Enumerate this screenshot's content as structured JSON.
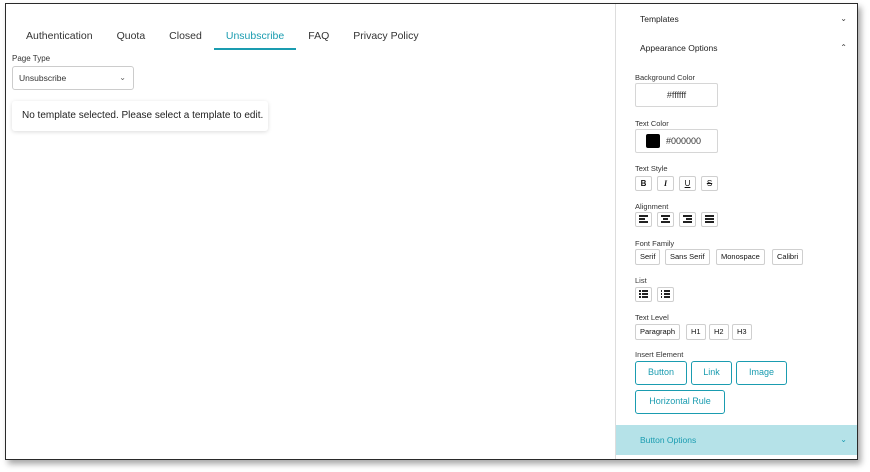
{
  "tabs": [
    {
      "label": "Authentication",
      "active": false
    },
    {
      "label": "Quota",
      "active": false
    },
    {
      "label": "Closed",
      "active": false
    },
    {
      "label": "Unsubscribe",
      "active": true
    },
    {
      "label": "FAQ",
      "active": false
    },
    {
      "label": "Privacy Policy",
      "active": false
    }
  ],
  "page_type": {
    "label": "Page Type",
    "selected": "Unsubscribe"
  },
  "notice": "No template selected. Please select a template to edit.",
  "sidebar": {
    "templates_header": "Templates",
    "appearance_header": "Appearance Options",
    "background_color": {
      "label": "Background Color",
      "value": "#ffffff"
    },
    "text_color": {
      "label": "Text Color",
      "value": "#000000"
    },
    "text_style": {
      "label": "Text Style",
      "buttons": [
        "B",
        "I",
        "U",
        "S"
      ]
    },
    "alignment": {
      "label": "Alignment"
    },
    "font_family": {
      "label": "Font Family",
      "options": [
        "Serif",
        "Sans Serif",
        "Monospace",
        "Calibri"
      ]
    },
    "list": {
      "label": "List"
    },
    "text_level": {
      "label": "Text Level",
      "options": [
        "Paragraph",
        "H1",
        "H2",
        "H3"
      ]
    },
    "insert_element": {
      "label": "Insert Element",
      "buttons": [
        "Button",
        "Link",
        "Image",
        "Horizontal Rule"
      ]
    },
    "button_options_header": "Button Options"
  },
  "colors": {
    "accent": "#1a9cb0",
    "highlight_bg": "#b5e2e8"
  }
}
